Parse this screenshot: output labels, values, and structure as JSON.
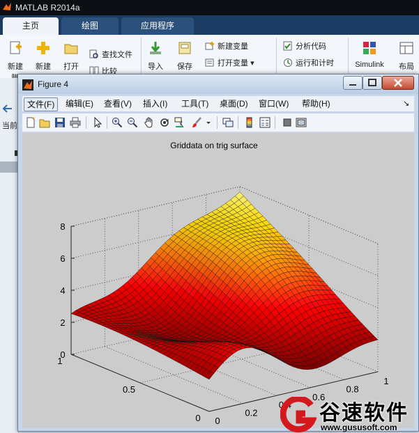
{
  "matlab": {
    "title": "MATLAB R2014a",
    "tabs": [
      "主页",
      "绘图",
      "应用程序"
    ],
    "ribbon": {
      "new_script": "新建",
      "new_script_2": "脚",
      "new": "新建",
      "open": "打开",
      "find_files": "查找文件",
      "compare": "比较",
      "import": "导入",
      "save": "保存",
      "new_variable": "新建变量",
      "open_variable": "打开变量",
      "analyze_code": "分析代码",
      "run_and_time": "运行和计时",
      "simulink": "Simulink",
      "layout": "布局"
    },
    "left_label": "当前"
  },
  "figure": {
    "title": "Figure 4",
    "menu": [
      "文件(F)",
      "编辑(E)",
      "查看(V)",
      "插入(I)",
      "工具(T)",
      "桌面(D)",
      "窗口(W)",
      "帮助(H)"
    ],
    "menu_overflow": "↘",
    "toolbar_icons": [
      "new-figure-icon",
      "open-file-icon",
      "save-icon",
      "print-icon",
      "select-arrow-icon",
      "zoom-in-icon",
      "zoom-out-icon",
      "pan-hand-icon",
      "rotate-3d-icon",
      "data-cursor-icon",
      "brush-icon",
      "link-plot-icon",
      "colorbar-icon",
      "legend-icon",
      "hide-plot-tools-icon",
      "show-plot-tools-icon"
    ]
  },
  "chart_data": {
    "type": "surface",
    "title": "Griddata on trig surface",
    "z_ticks": [
      "0",
      "2",
      "4",
      "6",
      "8"
    ],
    "y_ticks": [
      "0",
      "0.5",
      "1"
    ],
    "x_ticks": [
      "0",
      "0.2",
      "0.4",
      "0.6",
      "0.8",
      "1"
    ],
    "xlim": [
      0,
      1
    ],
    "ylim": [
      0,
      1
    ],
    "zlim": [
      0,
      8
    ],
    "grid": true,
    "colormap": "hot"
  },
  "watermark": {
    "brand": "谷速软件",
    "url": "www.gususoft.com"
  }
}
